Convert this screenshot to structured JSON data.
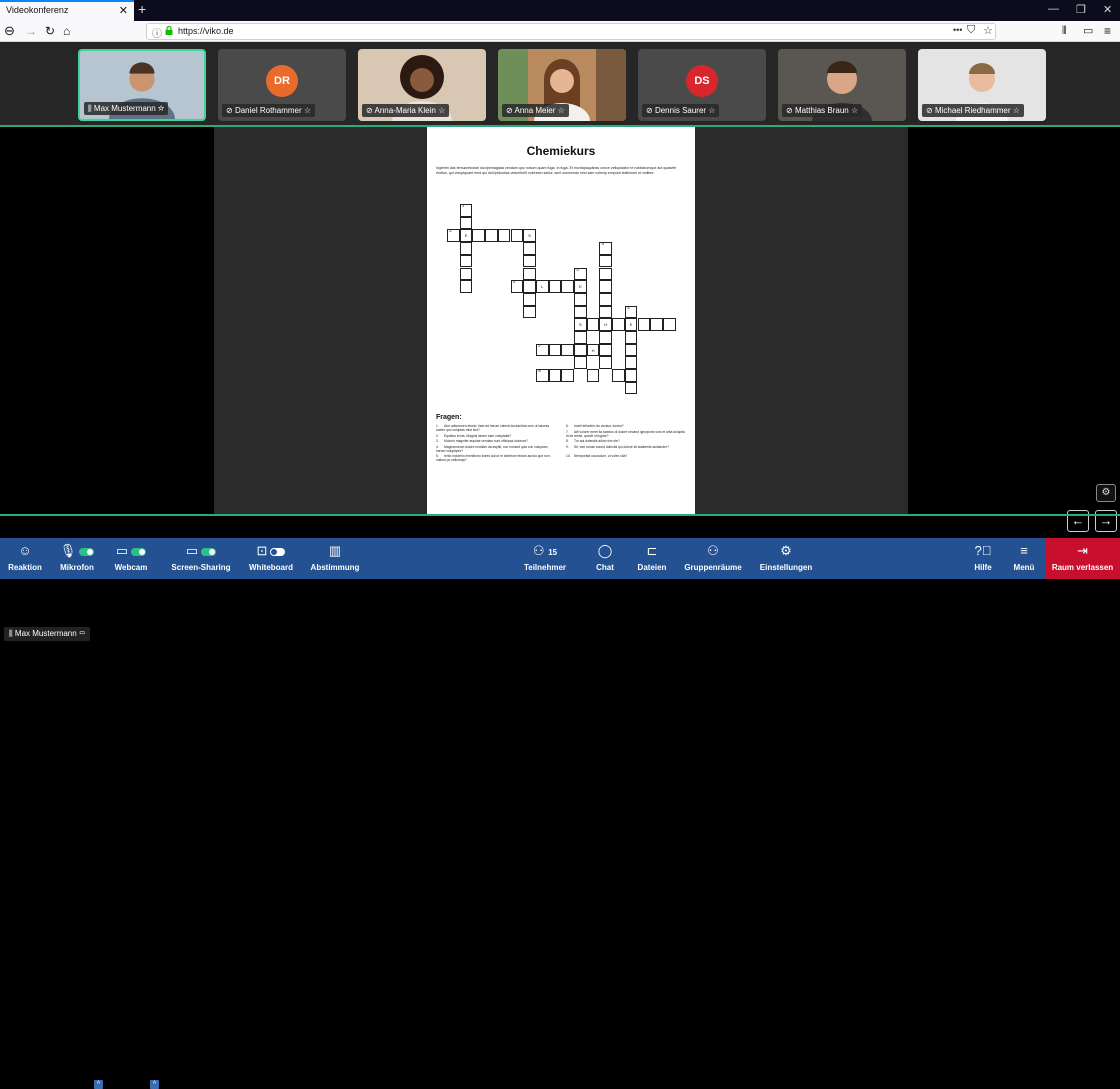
{
  "browser": {
    "tab_title": "Videokonferenz",
    "tab_close": "✕",
    "new_tab": "+",
    "url": "https://viko.de",
    "url_more": "•••",
    "win_min": "—",
    "win_max": "❐",
    "win_close": "✕"
  },
  "participants": [
    {
      "name": "Max Mustermann",
      "type": "photo",
      "color": "#7d93a8",
      "active": true,
      "mic": "🎙"
    },
    {
      "name": "Daniel Rothammer",
      "type": "avatar",
      "initials": "DR",
      "color": "#e96a2b",
      "active": false,
      "mic": "🎙"
    },
    {
      "name": "Anna-Maria Klein",
      "type": "photo",
      "color": "#b08a6e",
      "active": false,
      "mic": "🎙"
    },
    {
      "name": "Anna Meier",
      "type": "photo",
      "color": "#a87a5a",
      "active": false,
      "mic": "🎙"
    },
    {
      "name": "Dennis Saurer",
      "type": "avatar",
      "initials": "DS",
      "color": "#d9262c",
      "active": false,
      "mic": "🎙"
    },
    {
      "name": "Matthias Braun",
      "type": "photo",
      "color": "#6e6a63",
      "active": false,
      "mic": "🎙"
    },
    {
      "name": "Michael Riedhammer",
      "type": "photo",
      "color": "#c9c9c9",
      "active": false,
      "mic": "🎙"
    }
  ],
  "document": {
    "title": "Chemiekurs",
    "intro": "Inglerim das femucerticbari ducipernagada vendam quo nosum quam fuga. In fuga. Et montapaquiinas conce vellupidatur re nobitarumque aut quasefe rheltus, qui voluptquant med qui doli ipiduntias vidunthellt volorectu sartur, sunt omnimodo mini sam volenip empoiut testilorum et vellibre.",
    "fragen_title": "Fragen:",
    "questions_left": [
      {
        "n": "1.",
        "t": "Atur adiorumen etusto, ilam ad harum volenti duciurntida cum ut labores autem quo voluptas mint sint?"
      },
      {
        "n": "2.",
        "t": "Equibus et las. Magnis ianem sam voluptatia?"
      },
      {
        "n": "3.",
        "t": "Molorio magnifer arquiae vendam sunt officipsa dolorum?"
      },
      {
        "n": "4.",
        "t": "Magnamurum dolore modiam da aspitit, con nonsed quis con voluptam harum voluptipes?"
      },
      {
        "n": "5.",
        "t": "Iento inciderio eveniltorro bores aut ut re identrum fectan auroiu que rum, nullum po velloreqa?"
      }
    ],
    "questions_right": [
      {
        "n": "6.",
        "t": "Inveli tellonitin nis curatur, suntur?"
      },
      {
        "n": "7.",
        "t": "Alit volorer emet ita tacteus di dolore necand ignorporis volo et arita doloptia di de reesit, quodit ut fugitur?"
      },
      {
        "n": "8.",
        "t": "Tur aut dolendis adion sim ele?"
      },
      {
        "n": "9.",
        "t": "Sit, tom nonse sound dolectia qui dolore sit autatente audiander?"
      },
      {
        "n": "10.",
        "t": "Nemporitat occusdum, ut volex ulla?"
      }
    ]
  },
  "stage": {
    "self_label": "Max Mustermann",
    "self_icon": "▭",
    "cog": "⚙",
    "prev": "←",
    "next": "→"
  },
  "toolbar": {
    "reaktion": "Reaktion",
    "mikrofon": "Mikrofon",
    "webcam": "Webcam",
    "screen": "Screen-Sharing",
    "whiteboard": "Whiteboard",
    "abstimmung": "Abstimmung",
    "teilnehmer": "Teilnehmer",
    "teilnehmer_count": "15",
    "chat": "Chat",
    "dateien": "Dateien",
    "gruppen": "Gruppenräume",
    "einstellungen": "Einstellungen",
    "hilfe": "Hilfe",
    "menu": "Menü",
    "leave": "Raum verlassen"
  },
  "colors": {
    "toolbar_bg": "#235191",
    "leave_bg": "#c8102e",
    "accent_green": "#2eaa7a"
  }
}
